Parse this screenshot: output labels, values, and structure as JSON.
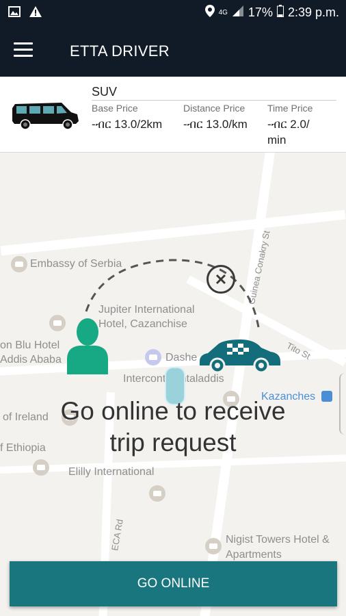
{
  "status_bar": {
    "network": "4G",
    "battery": "17%",
    "time": "2:39 p.m."
  },
  "app_bar": {
    "title": "ETTA DRIVER"
  },
  "vehicle": {
    "type": "SUV",
    "prices": [
      {
        "label": "Base Price",
        "value": "-ብር 13.0/2km"
      },
      {
        "label": "Distance Price",
        "value": "-ብር 13.0/km"
      },
      {
        "label": "Time Price",
        "value": "-ብር 2.0/ min"
      }
    ]
  },
  "map": {
    "labels": {
      "embassy": "Embassy of Serbia",
      "jupiter": "Jupiter International Hotel, Cazanchise",
      "blu": "on Blu Hotel Addis Ababa",
      "dashen": "Dashe",
      "interc": "Intercontinentaladdis",
      "kazanches": "Kazanches",
      "ireland": "of Ireland",
      "ethiopia": "f Ethiopia",
      "elilly": "Elilly International",
      "guinea": "Guinea Conakry St",
      "tito": "Tito St",
      "eca": "ECA Rd",
      "nigist": "Nigist Towers Hotel & Apartments"
    }
  },
  "message": {
    "line1": "Go online to receive",
    "line2": "trip request"
  },
  "button": {
    "go_online": "GO ONLINE"
  }
}
